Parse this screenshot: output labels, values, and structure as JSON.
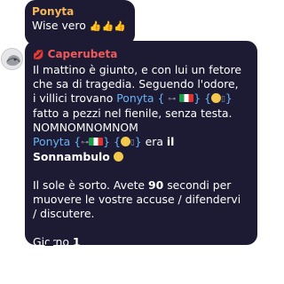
{
  "messages": [
    {
      "author": "Ponyta",
      "text": "Wise vero",
      "reactions": "👍👍👍"
    },
    {
      "author": "Caperubeta",
      "author_icon": "red-lips-icon",
      "lines": {
        "l1": "Il mattino è giunto, e con lui un fetore",
        "l2": "che sa di tragedia.  Seguendo l'odore,",
        "l3_pre": "i villici trovano ",
        "l3_name": "Ponyta",
        "l3_tags": " {",
        "l4": "fatto a pezzi nel fienile, senza testa.",
        "l5": "NOMNOMNOMNOM",
        "l6_name": "Ponyta",
        "l6_mid": " era ",
        "l6_bold": "il",
        "l7_bold": "Sonnambulo",
        "l9": "Il sole è sorto. Avete ",
        "l9_bold": "90",
        "l9_post": " secondi per",
        "l10": "muovere le vostre accuse / difendervi",
        "l11": "/ discutere.",
        "l13": "Giorno ",
        "l13_bold": "1"
      }
    }
  ],
  "colors": {
    "bubble": "#1c1b33",
    "ponyta_name": "#f6b65a",
    "caperubeta_name": "#f05a5a",
    "link": "#6ab4f5"
  }
}
